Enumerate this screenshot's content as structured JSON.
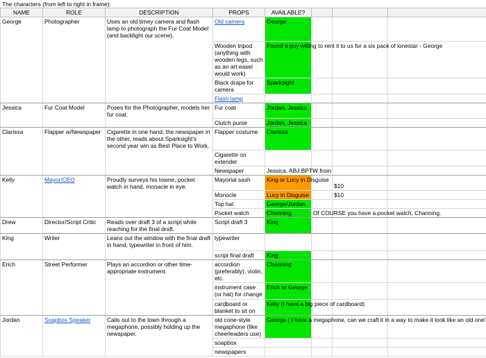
{
  "sheet_title": "The characters (from left to right in frame):",
  "headers": [
    "NAME",
    "ROLE",
    "DESCRIPTION",
    "PROPS",
    "AVAILABLE?"
  ],
  "colors": {
    "available_green": "#00e600",
    "orange": "#ff9900",
    "link_blue": "#1155cc"
  },
  "rows": [
    {
      "name": "George",
      "role": "Photographer",
      "description": "Uses an old timey camera and flash lamp to photograph the Fur Coat Model (and backlight our scene).",
      "prop": "Old camera",
      "available": "George",
      "color": "green"
    },
    {
      "prop": "Wooden tripod (anything with wooden legs, such as an art easel would work)",
      "available": "Found a guy willing to rent it to us for a six pack of lonestar - George",
      "color": "green"
    },
    {
      "prop": "Black drape for camera",
      "available": "Sparksight",
      "color": "green"
    },
    {
      "prop": "Flash lamp",
      "available": "",
      "color": ""
    },
    {
      "name": "Jessica",
      "role": "Fur Coat Model",
      "description": "Poses for the Photographer, models her fur coat.",
      "prop": "Fur coat",
      "available": "Jordan, Jessica",
      "color": "green"
    },
    {
      "prop": "Clutch purse",
      "available": "Jordan, Jessica",
      "color": "green"
    },
    {
      "name": "Clarissa",
      "role": "Flapper w/Newspaper",
      "description": "Cigarette in one hand, the newspaper in the other, reads about Sparksight's second year win as Best Place to Work.",
      "prop": "Flapper costume",
      "available": "Clarissa",
      "color": "green"
    },
    {
      "prop": "Cigarette on extender",
      "available": "",
      "color": ""
    },
    {
      "prop": "Newspaper",
      "available": "Jessica, ABJ BPTW from",
      "color": ""
    },
    {
      "name": "Kelly",
      "role": "Mayor/CEO",
      "description": "Proudly surveys his towne, pocket watch in hand, monacle in eye.",
      "prop": "Mayorial sash",
      "available": "King or Lucy in Disguise",
      "color": "orange",
      "extra": "$10"
    },
    {
      "prop": "Monocle",
      "available": "Lucy in Disguise",
      "color": "orange",
      "extra": "$10"
    },
    {
      "prop": "Top hat",
      "available": "George/Jordan",
      "color": "green"
    },
    {
      "prop": "Pocket watch",
      "available": "Channing",
      "color": "green",
      "extra": "Of COURSE you have a pocket watch, Channing."
    },
    {
      "name": "Drew",
      "role": "Director/Script Critic",
      "description": "Reads over draft 3 of a script while reaching for the final draft.",
      "prop": "Script draft 3",
      "available": "King",
      "color": "green"
    },
    {
      "name": "King",
      "role": "Writer",
      "description": "Leans out the window with the final draft in hand, typewriter in front of him.",
      "prop": "typewriter",
      "available": "",
      "color": ""
    },
    {
      "prop": "script final draft",
      "available": "King",
      "color": "green"
    },
    {
      "name": "Erich",
      "role": "Street Performer",
      "description": "Plays an accordion or other time-appropriate instrument.",
      "prop": "accordion (preferably), violin, etc.",
      "available": "Channing",
      "color": "green"
    },
    {
      "prop": "instrument case (or hat) for change",
      "available": "Erich or George",
      "color": "green"
    },
    {
      "prop": "cardboard or blanket to sit on",
      "available": "Kelly (I have a big piece of cardboard)",
      "color": "green"
    },
    {
      "name": "Jordan",
      "role": "Soapbox Speaker",
      "description": "Calls out to the town through a megaphone, possibly holding up the newspaper.",
      "prop": "old cone-style megaphone (like cheerleaders use)",
      "available": "George ( I have a megaphone, can we craft it in a way to make it look like an old one?)",
      "color": "green"
    },
    {
      "prop": "soapbox",
      "available": "",
      "color": ""
    },
    {
      "prop": "newspapers",
      "available": "",
      "color": ""
    }
  ]
}
